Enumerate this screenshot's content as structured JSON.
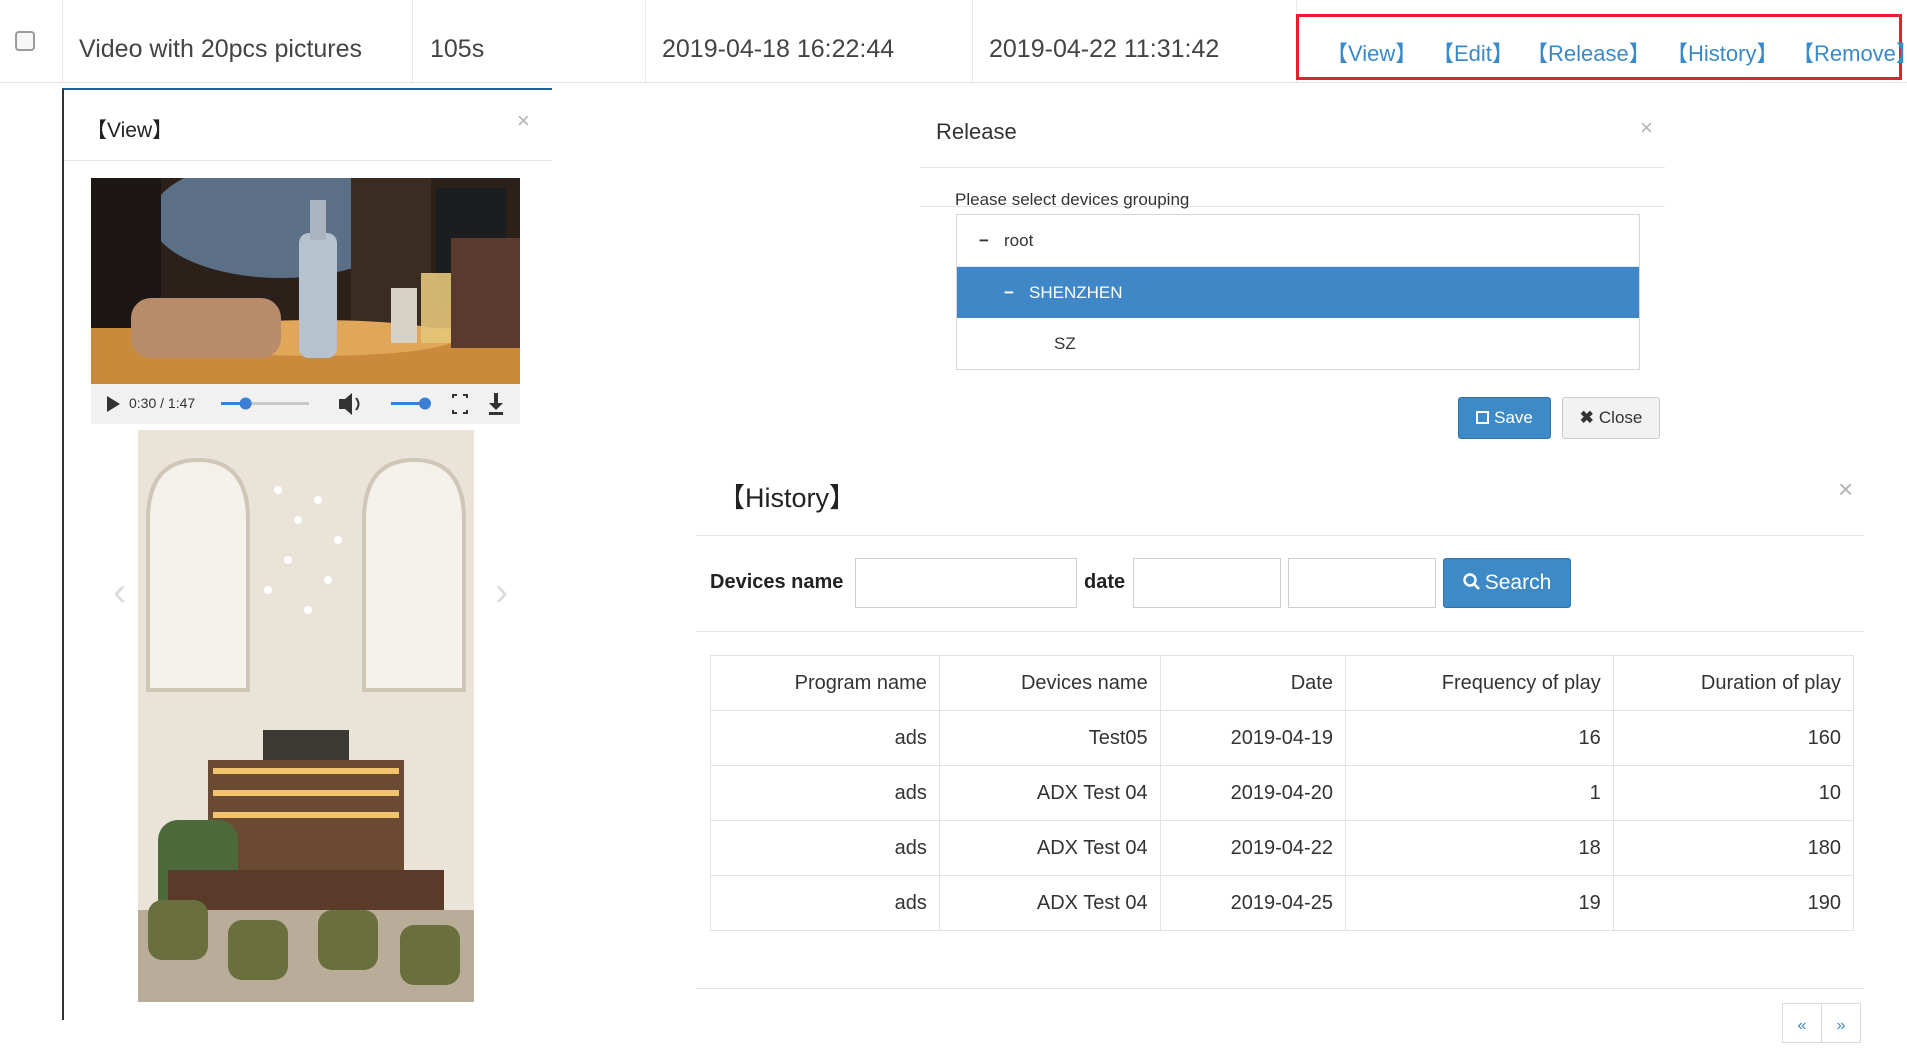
{
  "top_row": {
    "name": "Video with 20pcs pictures",
    "duration": "105s",
    "created": "2019-04-18 16:22:44",
    "updated": "2019-04-22 11:31:42",
    "actions": {
      "view": "【View】",
      "edit": "【Edit】",
      "release": "【Release】",
      "history": "【History】",
      "remove": "【Remove】"
    }
  },
  "view_modal": {
    "title": "【View】",
    "close": "×",
    "video": {
      "time": "0:30 / 1:47",
      "progress": 0.28,
      "volume": 1.0
    },
    "carousel": {
      "prev": "‹",
      "next": "›"
    }
  },
  "release_modal": {
    "title": "Release",
    "close": "×",
    "label": "Please select devices grouping",
    "tree": [
      {
        "label": "root",
        "marker": "−",
        "selected": false
      },
      {
        "label": "SHENZHEN",
        "marker": "−",
        "selected": true
      },
      {
        "label": "SZ",
        "marker": "",
        "selected": false
      }
    ],
    "save_label": "Save",
    "close_label": "Close"
  },
  "history_modal": {
    "title": "【History】",
    "close": "×",
    "devices_label": "Devices name",
    "date_label": "date",
    "search_label": "Search",
    "columns": [
      "Program name",
      "Devices name",
      "Date",
      "Frequency of play",
      "Duration of play"
    ],
    "rows": [
      [
        "ads",
        "Test05",
        "2019-04-19",
        "16",
        "160"
      ],
      [
        "ads",
        "ADX Test 04",
        "2019-04-20",
        "1",
        "10"
      ],
      [
        "ads",
        "ADX Test 04",
        "2019-04-22",
        "18",
        "180"
      ],
      [
        "ads",
        "ADX Test 04",
        "2019-04-25",
        "19",
        "190"
      ]
    ],
    "pager": {
      "prev": "«",
      "next": "»"
    }
  },
  "colors": {
    "accent": "#3d8ac7",
    "selected_row": "#3f87c6",
    "highlight_box": "#e3202b",
    "link": "#3a89c9"
  }
}
